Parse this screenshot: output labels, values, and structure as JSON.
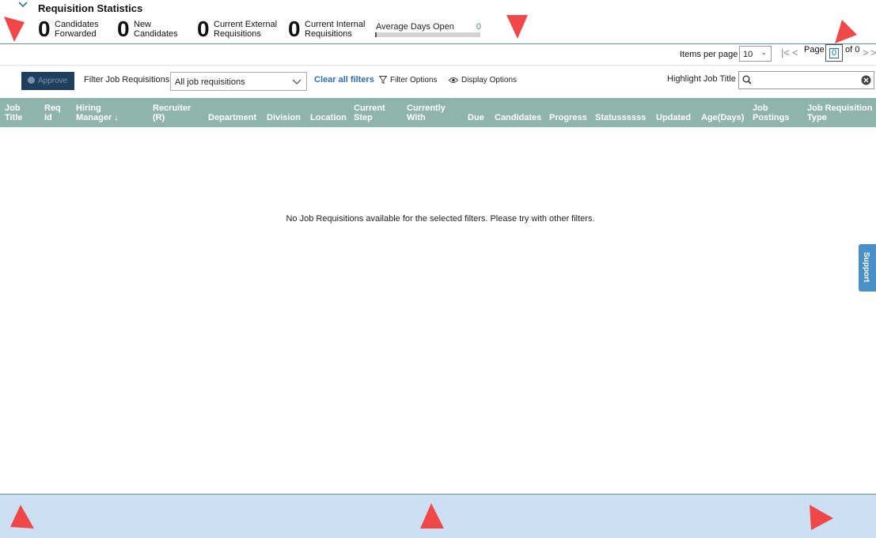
{
  "stats": {
    "title": "Requisition Statistics",
    "items": [
      {
        "value": "0",
        "line1": "Candidates",
        "line2": "Forwarded"
      },
      {
        "value": "0",
        "line1": "New",
        "line2": "Candidates"
      },
      {
        "value": "0",
        "line1": "Current External",
        "line2": "Requisitions"
      },
      {
        "value": "0",
        "line1": "Current Internal",
        "line2": "Requisitions"
      }
    ],
    "avg_label": "Average Days Open",
    "avg_value": "0",
    "avg_progress": 0
  },
  "pagination": {
    "items_per_page_label": "Items per page",
    "items_per_page": "10",
    "page_label": "Page",
    "current_page": "0",
    "of_label": "of 0",
    "first": "|<",
    "prev": "<",
    "next": ">",
    "last": ">>"
  },
  "toolbar": {
    "approve_label": "Approve",
    "filter_label": "Filter Job Requisitions",
    "filter_value": "All job requisitions",
    "clear_filters": "Clear all filters",
    "filter_options": "Filter Options",
    "display_options": "Display Options",
    "highlight_label": "Highlight Job Title",
    "highlight_value": ""
  },
  "table": {
    "columns": [
      {
        "l1": "Job",
        "l2": "Title"
      },
      {
        "l1": "Req",
        "l2": "Id"
      },
      {
        "l1": "Hiring",
        "l2": "Manager ↓"
      },
      {
        "l1": "Recruiter",
        "l2": "(R)"
      },
      {
        "l1": "",
        "l2": "Department"
      },
      {
        "l1": "",
        "l2": "Division"
      },
      {
        "l1": "",
        "l2": "Location"
      },
      {
        "l1": "Current",
        "l2": "Step"
      },
      {
        "l1": "Currently",
        "l2": "With"
      },
      {
        "l1": "",
        "l2": "Due"
      },
      {
        "l1": "",
        "l2": "Candidates"
      },
      {
        "l1": "",
        "l2": "Progress"
      },
      {
        "l1": "",
        "l2": "Statussssss"
      },
      {
        "l1": "",
        "l2": "Updated"
      },
      {
        "l1": "",
        "l2": "Age(Days)"
      },
      {
        "l1": "Job",
        "l2": "Postings"
      },
      {
        "l1": "Job Requisition",
        "l2": "Type"
      }
    ],
    "empty_message": "No Job Requisitions available for the selected filters. Please try with other filters."
  },
  "support": {
    "label": "Support"
  },
  "colors": {
    "header_bg": "#8fb4ab",
    "approve_bg": "#1e3f5e",
    "link": "#2f6db5",
    "footer_bg": "#cddff3",
    "support_bg": "#4a90c8",
    "marker": "#f04848"
  }
}
